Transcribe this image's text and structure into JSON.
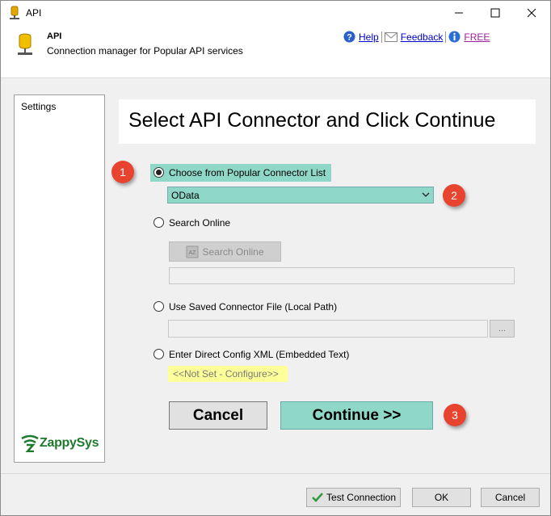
{
  "window": {
    "title": "API"
  },
  "header": {
    "name": "API",
    "description": "Connection manager for Popular API services",
    "links": {
      "help": "Help",
      "feedback": "Feedback",
      "free": "FREE"
    }
  },
  "sidebar": {
    "items": [
      {
        "label": "Settings"
      }
    ],
    "logo_text": "ZappySys"
  },
  "main": {
    "heading": "Select API Connector and Click Continue",
    "options": {
      "popular": "Choose from Popular Connector List",
      "search_online": "Search Online",
      "saved_file": "Use Saved Connector File (Local Path)",
      "direct_xml": "Enter Direct Config XML (Embedded Text)"
    },
    "selected_connector": "OData",
    "search_button": "Search Online",
    "browse_button": "...",
    "not_set": "<<Not Set - Configure>>",
    "cancel_button": "Cancel",
    "continue_button": "Continue >>"
  },
  "callouts": [
    "1",
    "2",
    "3"
  ],
  "footer": {
    "test_connection": "Test Connection",
    "ok": "OK",
    "cancel": "Cancel"
  },
  "colors": {
    "highlight": "#8fd8c7",
    "callout": "#e8432e",
    "not_set_bg": "#ffff99",
    "logo": "#1f7a2d"
  }
}
